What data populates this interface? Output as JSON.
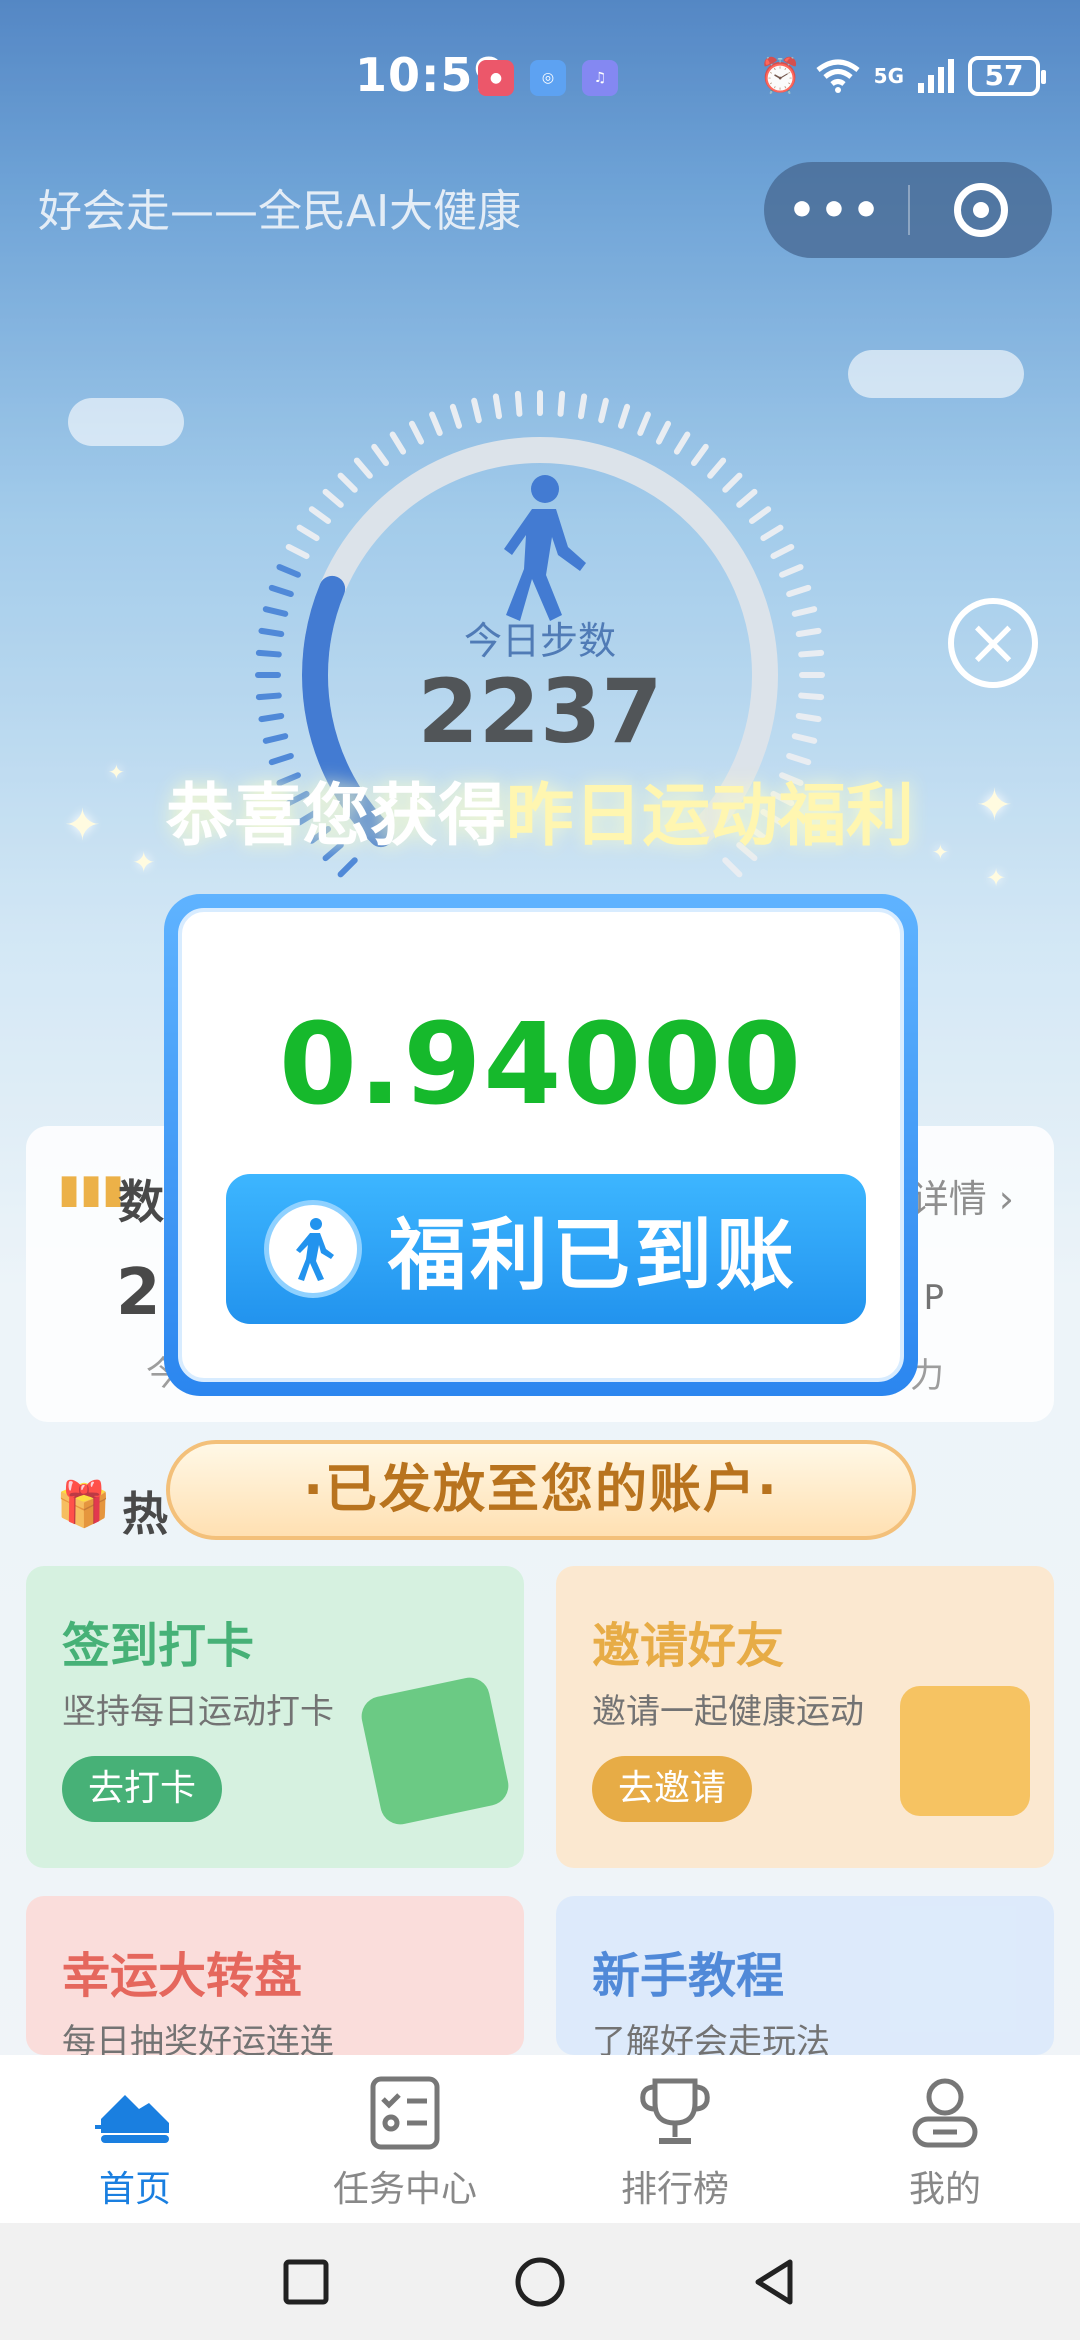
{
  "status_bar": {
    "time": "10:59",
    "network": "5G",
    "battery": "57",
    "apps": [
      "red-app-icon",
      "browser-icon",
      "music-icon"
    ],
    "icons": [
      "alarm-icon",
      "wifi-icon",
      "signal-icon",
      "battery-icon"
    ]
  },
  "header": {
    "title": "好会走——全民AI大健康",
    "more_label": "•••"
  },
  "steps": {
    "label": "今日步数",
    "value": "2237",
    "progress_fraction": 0.25
  },
  "data_card": {
    "title": "数",
    "detail_label": "详情",
    "number": "2",
    "sub": "今",
    "right_top": "P",
    "right_bottom": "算力"
  },
  "hot": {
    "title": "热"
  },
  "tiles": [
    {
      "title": "签到打卡",
      "subtitle": "坚持每日运动打卡",
      "button": "去打卡",
      "accent": "#1fa05a",
      "bg": "#cdeed9"
    },
    {
      "title": "邀请好友",
      "subtitle": "邀请一起健康运动",
      "button": "去邀请",
      "accent": "#e29a1e",
      "bg": "#fbe3c6"
    },
    {
      "title": "幸运大转盘",
      "subtitle": "每日抽奖好运连连",
      "accent": "#e0463a",
      "bg": "#f9d6d3"
    },
    {
      "title": "新手教程",
      "subtitle": "了解好会走玩法",
      "accent": "#2a6fd0",
      "bg": "#d6e6fa"
    }
  ],
  "modal": {
    "congrats_prefix": "恭喜您获得",
    "congrats_highlight": "昨日运动福利",
    "amount": "0.94000",
    "button_label": "福利已到账",
    "sent_label": "·已发放至您的账户·",
    "close_label": "×"
  },
  "bottom_nav": {
    "items": [
      {
        "label": "首页",
        "icon": "sneaker-icon",
        "active": true
      },
      {
        "label": "任务中心",
        "icon": "task-list-icon",
        "active": false
      },
      {
        "label": "排行榜",
        "icon": "trophy-icon",
        "active": false
      },
      {
        "label": "我的",
        "icon": "profile-icon",
        "active": false
      }
    ]
  },
  "colors": {
    "accent_blue": "#1a7fe0",
    "amount_green": "#16b92c",
    "gold_text": "#b8731e"
  }
}
